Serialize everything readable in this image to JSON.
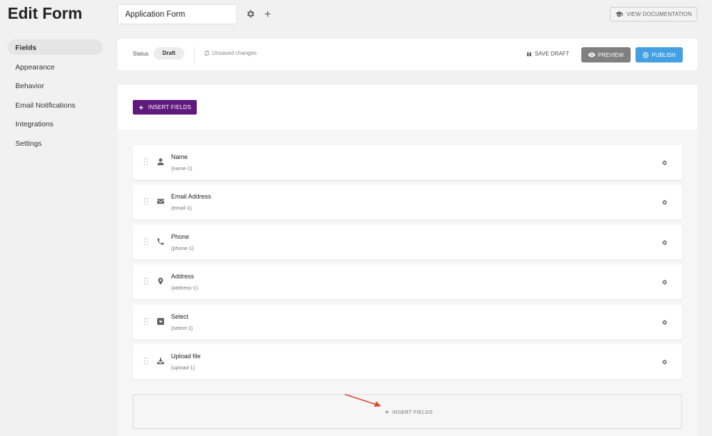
{
  "page": {
    "title": "Edit Form"
  },
  "header": {
    "form_name": "Application Form",
    "doc_button": "VIEW DOCUMENTATION"
  },
  "sidebar": {
    "items": [
      {
        "label": "Fields",
        "active": true
      },
      {
        "label": "Appearance"
      },
      {
        "label": "Behavior"
      },
      {
        "label": "Email Notifications"
      },
      {
        "label": "Integrations"
      },
      {
        "label": "Settings"
      }
    ]
  },
  "statusbar": {
    "status_label": "Status",
    "status_value": "Draft",
    "unsaved": "Unsaved changes",
    "save_draft": "SAVE DRAFT",
    "preview": "PREVIEW",
    "publish": "PUBLISH"
  },
  "builder": {
    "insert_label": "INSERT FIELDS",
    "fields": [
      {
        "label": "Name",
        "key": "{name-1}",
        "icon": "user-icon"
      },
      {
        "label": "Email Address",
        "key": "{email-1}",
        "icon": "envelope-icon"
      },
      {
        "label": "Phone",
        "key": "{phone-1}",
        "icon": "phone-icon"
      },
      {
        "label": "Address",
        "key": "{address-1}",
        "icon": "map-pin-icon"
      },
      {
        "label": "Select",
        "key": "{select-1}",
        "icon": "dropdown-icon"
      },
      {
        "label": "Upload file",
        "key": "{upload-1}",
        "icon": "upload-icon"
      }
    ],
    "dropzone_label": "INSERT FIELDS"
  },
  "colors": {
    "accent_purple": "#601a7d",
    "publish_blue": "#43a0e2",
    "preview_gray": "#808080",
    "annotation_arrow": "#e0452a"
  }
}
